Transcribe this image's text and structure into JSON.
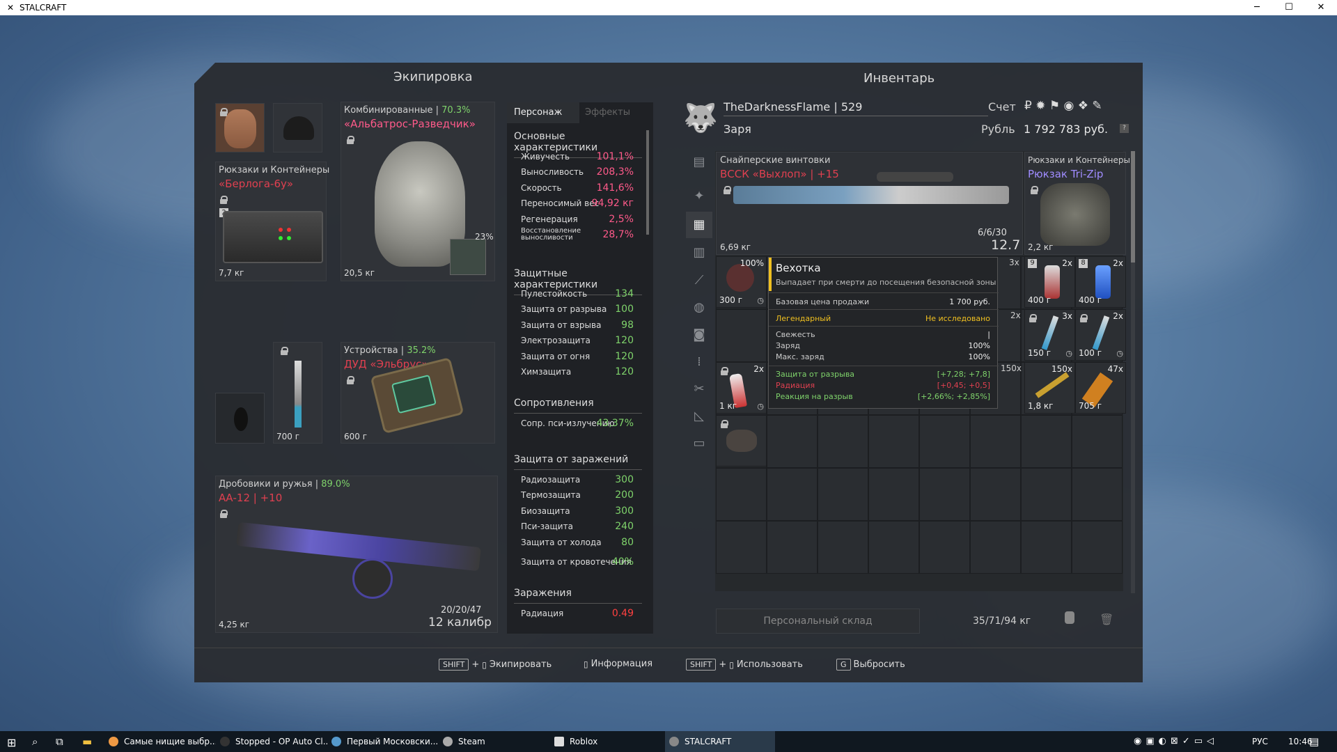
{
  "window": {
    "title": "STALCRAFT"
  },
  "equipment": {
    "title": "Экипировка",
    "backpack": {
      "category": "Рюкзаки и Контейнеры",
      "name": "«Берлога-6у»",
      "weight": "7,7 кг",
      "level": "2"
    },
    "armor": {
      "category": "Комбинированные |",
      "durability": "70.3%",
      "name": "«Альбатрос-Разведчик»",
      "weight": "20,5 кг",
      "patch_percent": "23%"
    },
    "knife": {
      "weight": "700 г"
    },
    "device": {
      "category": "Устройства |",
      "durability": "35.2%",
      "name": "ДУД «Эльбрус»",
      "weight": "600 г"
    },
    "weapon": {
      "category": "Дробовики и ружья |",
      "durability": "89.0%",
      "name": "АА-12 | +10",
      "weight": "4,25 кг",
      "ammo": "20/20/47",
      "caliber": "12 калибр"
    }
  },
  "stats": {
    "tabs": [
      "Персонаж",
      "Эффекты"
    ],
    "basic_title": "Основные характеристики",
    "basic": [
      {
        "name": "Живучесть",
        "value": "101,1%"
      },
      {
        "name": "Выносливость",
        "value": "208,3%"
      },
      {
        "name": "Скорость",
        "value": "141,6%"
      },
      {
        "name": "Переносимый вес",
        "value": "94,92 кг"
      },
      {
        "name": "Регенерация",
        "value": "2,5%"
      },
      {
        "name": "Восстановление выносливости",
        "value": "28,7%"
      }
    ],
    "protect_title": "Защитные характеристики",
    "protect": [
      {
        "name": "Пулестойкость",
        "value": "134"
      },
      {
        "name": "Защита от разрыва",
        "value": "100"
      },
      {
        "name": "Защита от взрыва",
        "value": "98"
      },
      {
        "name": "Электрозащита",
        "value": "120"
      },
      {
        "name": "Защита от огня",
        "value": "120"
      },
      {
        "name": "Химзащита",
        "value": "120"
      }
    ],
    "resist_title": "Сопротивления",
    "resist": [
      {
        "name": "Сопр. пси-излучению",
        "value": "43,37%"
      }
    ],
    "infect_title": "Защита от заражений",
    "infect": [
      {
        "name": "Радиозащита",
        "value": "300"
      },
      {
        "name": "Термозащита",
        "value": "200"
      },
      {
        "name": "Биозащита",
        "value": "300"
      },
      {
        "name": "Пси-защита",
        "value": "240"
      },
      {
        "name": "Защита от холода",
        "value": "80"
      },
      {
        "name": "Защита от кровотечения",
        "value": "40%"
      }
    ],
    "contam_title": "Заражения",
    "contam": [
      {
        "name": "Радиация",
        "value": "0.49"
      }
    ]
  },
  "inventory": {
    "title": "Инвентарь",
    "player": "TheDarknessFlame | 529",
    "faction": "Заря",
    "account_label": "Счет",
    "currency_label": "Рубль",
    "money": "1 792 783 руб.",
    "rifle": {
      "category": "Снайперские винтовки",
      "name": "ВССК «Выхлоп» | +15",
      "weight": "6,69 кг",
      "ammo": "6/6/30",
      "caliber": "12.7"
    },
    "backpack": {
      "category": "Рюкзаки и Контейнеры",
      "name": "Рюкзак Tri-Zip",
      "weight": "2,2 кг"
    },
    "cells": [
      {
        "q": "100%",
        "w": "300 г"
      },
      {
        "q": "2x",
        "w": "400 г"
      },
      {
        "q": "2x",
        "w": "400 г"
      },
      {
        "q": "3x",
        "w": "150 г"
      },
      {
        "q": "2x",
        "w": "100 г"
      },
      {
        "q": "2x",
        "w": "1 кг"
      },
      {
        "q": "150x",
        "w": "1,8 кг"
      },
      {
        "q": "47x",
        "w": "705 г"
      }
    ],
    "partial_qty": [
      "3x",
      "2x",
      "150x"
    ],
    "storage": "Персональный склад",
    "weight": "35/71/94 кг"
  },
  "tooltip": {
    "title": "Вехотка",
    "subtitle": "Выпадает при смерти до посещения безопасной зоны",
    "price_label": "Базовая цена продажи",
    "price": "1 700 руб.",
    "rarity": "Легендарный",
    "research": "Не исследовано",
    "props": [
      {
        "n": "Свежесть",
        "v": "|"
      },
      {
        "n": "Заряд",
        "v": "100%"
      },
      {
        "n": "Макс. заряд",
        "v": "100%"
      }
    ],
    "effects": [
      {
        "n": "Защита от разрыва",
        "v": "[+7,28; +7,8]"
      },
      {
        "n": "Радиация",
        "v": "[+0,45; +0,5]"
      },
      {
        "n": "Реакция на разрыв",
        "v": "[+2,66%; +2,85%]"
      }
    ]
  },
  "hints": [
    {
      "key": "SHIFT",
      "plus": "+",
      "label": "Экипировать"
    },
    {
      "label": "Информация"
    },
    {
      "key": "SHIFT",
      "plus": "+",
      "label": "Использовать"
    },
    {
      "key": "G",
      "label": "Выбросить"
    }
  ],
  "taskbar": {
    "items": [
      "Самые нищие выбр...",
      "Stopped - OP Auto Cl...",
      "Первый Московски...",
      "Steam",
      "Roblox",
      "STALCRAFT"
    ],
    "lang": "РУС",
    "time": "10:46"
  }
}
